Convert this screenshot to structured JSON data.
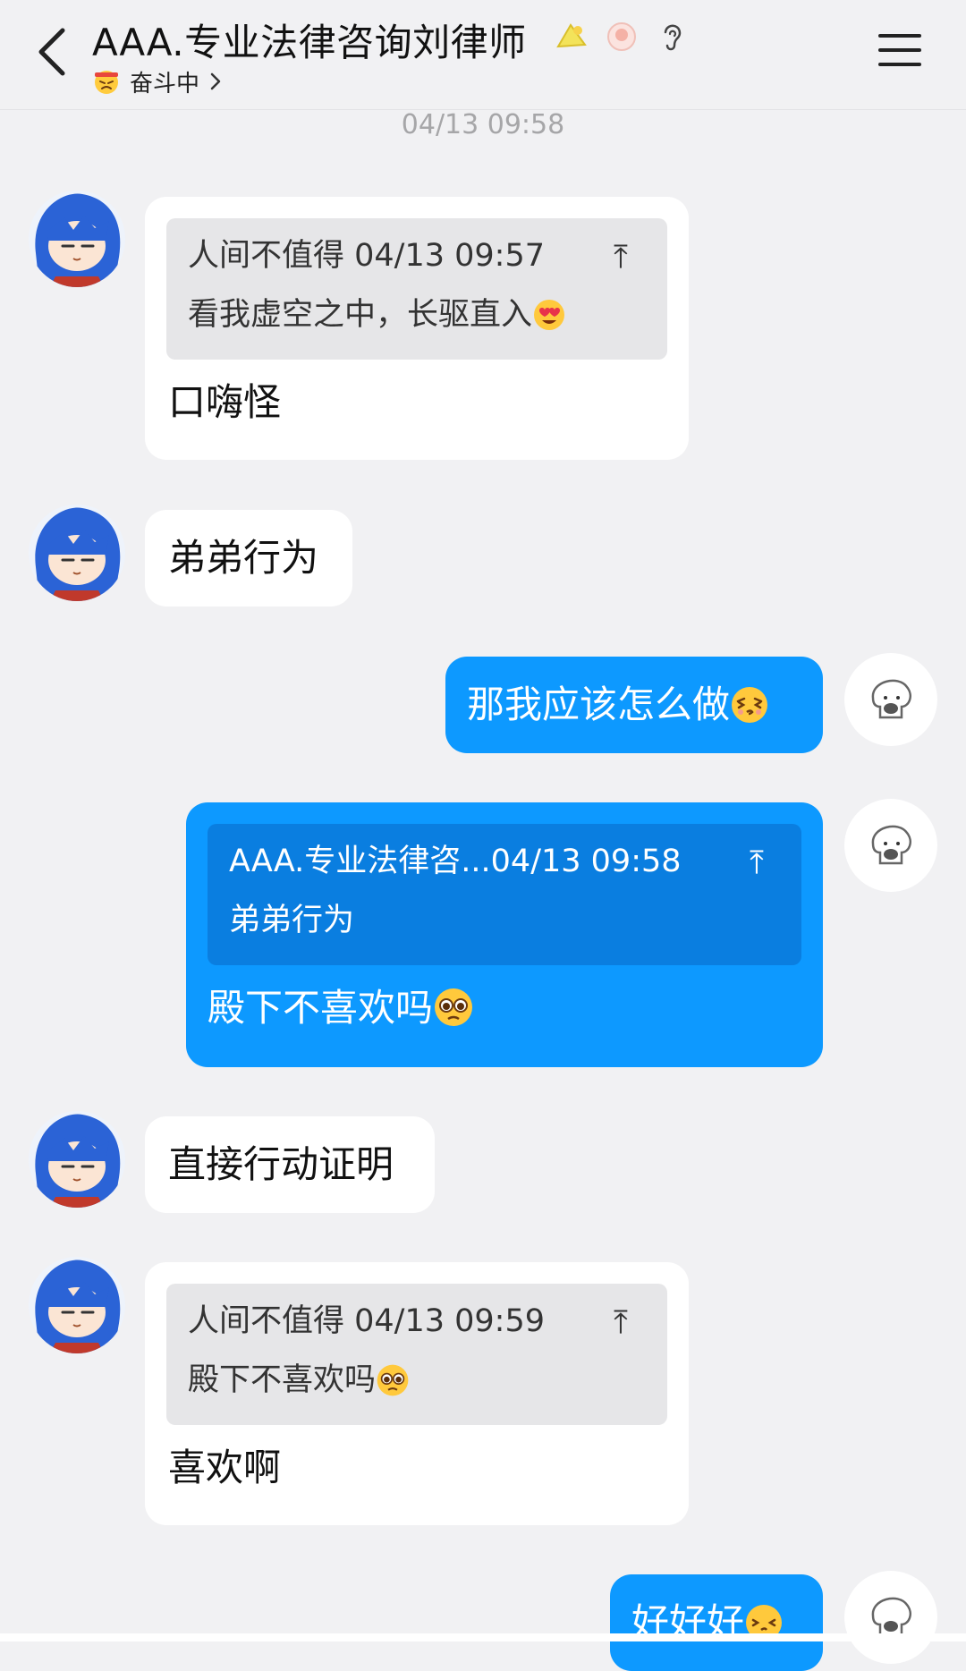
{
  "header": {
    "title": "AAA.专业法律咨询刘律师",
    "status": "奋斗中",
    "icons": [
      "back-arrow-icon",
      "badge-icon-1",
      "badge-icon-2",
      "ear-icon",
      "menu-icon",
      "status-emoji-icon",
      "chevron-right-icon"
    ]
  },
  "timestamp": "04/13 09:58",
  "messages": [
    {
      "side": "left",
      "quote": {
        "meta": "人间不值得 04/13 09:57",
        "text": "看我虚空之中，长驱直入"
      },
      "text": "口嗨怪"
    },
    {
      "side": "left",
      "text": "弟弟行为"
    },
    {
      "side": "right",
      "text": "那我应该怎么做"
    },
    {
      "side": "right",
      "quote": {
        "meta": "AAA.专业法律咨...04/13 09:58",
        "text": "弟弟行为"
      },
      "text": "殿下不喜欢吗"
    },
    {
      "side": "left",
      "text": "直接行动证明"
    },
    {
      "side": "left",
      "quote": {
        "meta": "人间不值得 04/13 09:59",
        "text": "殿下不喜欢吗"
      },
      "text": "喜欢啊"
    },
    {
      "side": "right",
      "text": "好好好"
    }
  ],
  "colors": {
    "background": "#f1f1f3",
    "my_bubble": "#0d99ff",
    "their_bubble": "#ffffff",
    "quote_left": "#e6e6e8",
    "quote_right": "#0a7ee0",
    "timestamp": "#a6a6a8"
  },
  "quote_up_glyph": "⤒"
}
